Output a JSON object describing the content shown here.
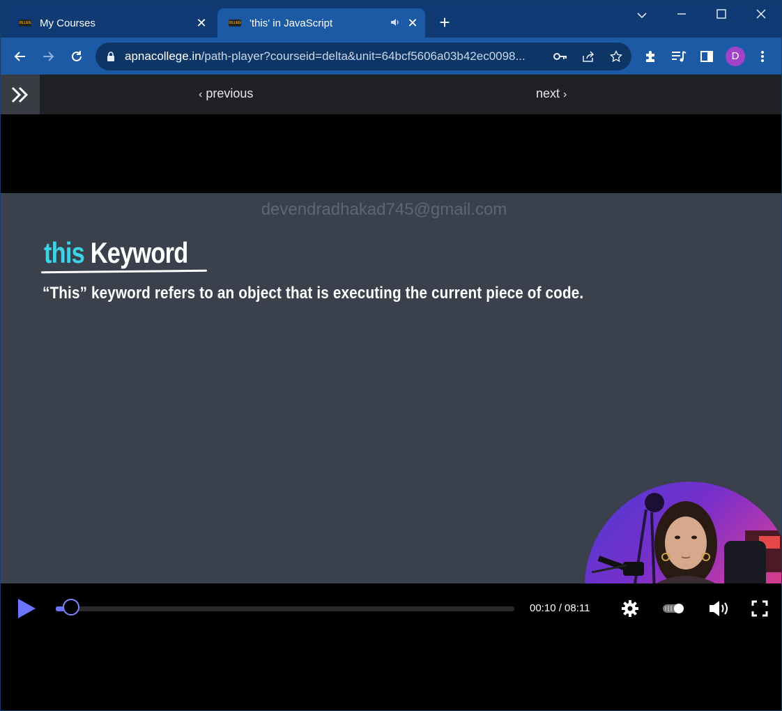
{
  "browser": {
    "tabs": [
      {
        "title": "My Courses",
        "active": false,
        "favicon": "COLLEGE"
      },
      {
        "title": "'this' in JavaScript",
        "active": true,
        "favicon": "COLLEGE",
        "audio": true
      }
    ],
    "url_host": "apnacollege.in",
    "url_path": "/path-player?courseid=delta&unit=64bcf5606a03b42ec0098...",
    "profile_initial": "D"
  },
  "page_nav": {
    "previous_label": "previous",
    "next_label": "next"
  },
  "slide": {
    "watermark": "devendradhakad745@gmail.com",
    "headline_this": "this",
    "headline_keyword": "Keyword",
    "description": "“This” keyword refers to an object that is executing the current piece of code."
  },
  "player": {
    "time": "00:10 / 08:11",
    "progress": 0.02,
    "accent_color": "#6b73ff"
  },
  "colors": {
    "tabstrip": "#0f3a74",
    "toolbar": "#1c5aa6",
    "slide_bg": "#3a414c",
    "this_color": "#3cd4e6"
  }
}
